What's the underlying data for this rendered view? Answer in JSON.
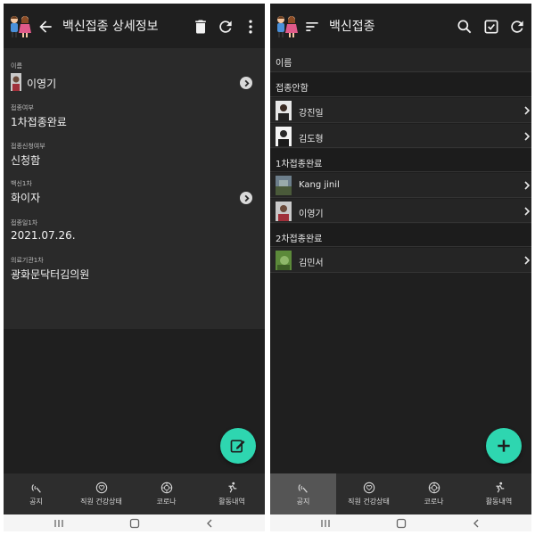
{
  "left": {
    "title": "백신접종 상세정보",
    "fields": [
      {
        "label": "이름",
        "value": "이영기"
      },
      {
        "label": "접종여부",
        "value": "1차접종완료"
      },
      {
        "label": "접종신청여부",
        "value": "신청함"
      },
      {
        "label": "백신1차",
        "value": "화이자"
      },
      {
        "label": "접종일1차",
        "value": "2021.07.26."
      },
      {
        "label": "의료기관1차",
        "value": "광화문닥터김의원"
      }
    ]
  },
  "right": {
    "title": "백신접종",
    "column_header": "이름",
    "groups": [
      {
        "label": "접종안함",
        "items": [
          "강진일",
          "김도형"
        ]
      },
      {
        "label": "1차접종완료",
        "items": [
          "Kang jinil",
          "이영기"
        ]
      },
      {
        "label": "2차접종완료",
        "items": [
          "김민서"
        ]
      }
    ]
  },
  "tabs": [
    {
      "label": "공지",
      "icon": "notice-icon"
    },
    {
      "label": "직원 건강상태",
      "icon": "heart-icon"
    },
    {
      "label": "코로나",
      "icon": "virus-icon"
    },
    {
      "label": "활동내역",
      "icon": "running-icon"
    }
  ],
  "colors": {
    "accent": "#2ed6b0",
    "background": "#1f1f1f",
    "bottom_bar": "#2d2d2d"
  }
}
